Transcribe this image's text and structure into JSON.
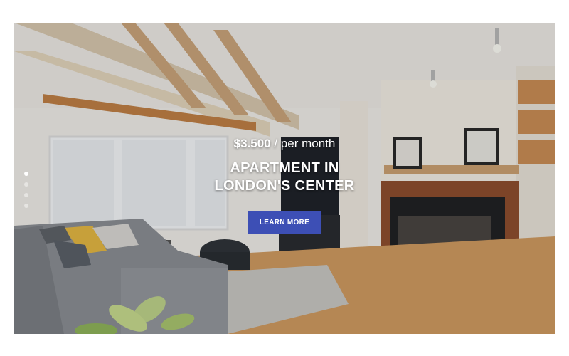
{
  "slide": {
    "price_amount": "$3.500",
    "price_period": " / per month",
    "title_line1": "APARTMENT IN",
    "title_line2": "LONDON'S CENTER",
    "button_label": "LEARN MORE"
  },
  "pagination": {
    "total": 4,
    "active_index": 0
  },
  "colors": {
    "button": "#3d4fb5",
    "caption_text": "#ffffff"
  }
}
